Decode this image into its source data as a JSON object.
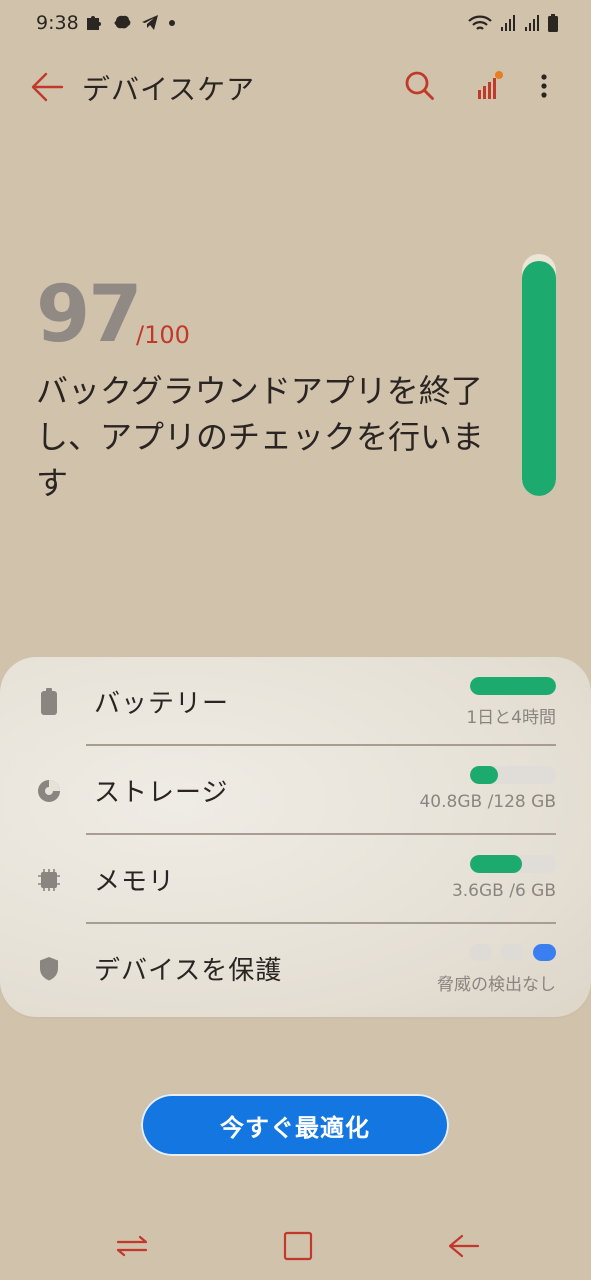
{
  "status_bar": {
    "time": "9:38"
  },
  "app_bar": {
    "title": "デバイスケア"
  },
  "score": {
    "value": "97",
    "max_label": "/100",
    "message": "バックグラウンドアプリを終了し、アプリのチェックを行います",
    "gauge_fraction": 0.97
  },
  "items": [
    {
      "label": "バッテリー",
      "sub": "1日と4時間",
      "fill_fraction": 1.0,
      "icon": "battery-icon"
    },
    {
      "label": "ストレージ",
      "sub": "40.8GB /128 GB",
      "fill_fraction": 0.32,
      "icon": "storage-pie-icon"
    },
    {
      "label": "メモリ",
      "sub": "3.6GB /6 GB",
      "fill_fraction": 0.6,
      "icon": "memory-chip-icon"
    },
    {
      "label": "デバイスを保護",
      "sub": "脅威の検出なし",
      "icon": "shield-icon"
    }
  ],
  "optimize_button": {
    "label": "今すぐ最適化"
  },
  "colors": {
    "accent_red": "#c0392b",
    "green": "#1daa6e",
    "blue": "#1476e0",
    "background": "#d1c2ab"
  }
}
